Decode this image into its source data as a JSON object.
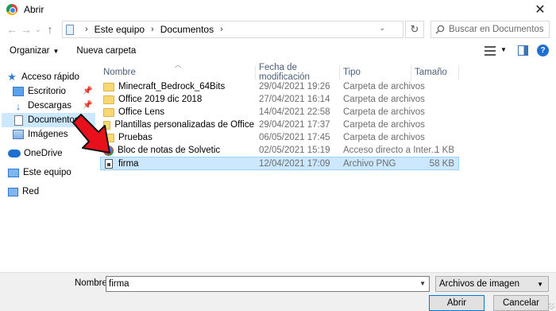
{
  "window": {
    "title": "Abrir",
    "close_glyph": "✕"
  },
  "nav_buttons": {
    "back": "←",
    "forward": "→",
    "recent": "⌄",
    "up": "↑"
  },
  "address": {
    "breadcrumbs": [
      "Este equipo",
      "Documentos"
    ],
    "separator": "›",
    "dropdown_glyph": "⌄",
    "refresh_glyph": "↻"
  },
  "search": {
    "placeholder": "Buscar en Documentos",
    "value": ""
  },
  "toolbar": {
    "organize_label": "Organizar",
    "new_folder_label": "Nueva carpeta"
  },
  "sidebar": {
    "items": [
      {
        "label": "Acceso rápido",
        "icon": "star-icon"
      },
      {
        "label": "Escritorio",
        "icon": "desktop-icon"
      },
      {
        "label": "Descargas",
        "icon": "download-icon"
      },
      {
        "label": "Documentos",
        "icon": "documents-icon",
        "selected": true
      },
      {
        "label": "Imágenes",
        "icon": "images-icon"
      },
      {
        "label": "OneDrive",
        "icon": "cloud-icon"
      },
      {
        "label": "Este equipo",
        "icon": "computer-icon"
      },
      {
        "label": "Red",
        "icon": "network-icon"
      }
    ]
  },
  "columns": {
    "name": "Nombre",
    "date": "Fecha de modificación",
    "type": "Tipo",
    "size": "Tamaño"
  },
  "files": [
    {
      "name": "Minecraft_Bedrock_64Bits",
      "date": "29/04/2021 19:26",
      "type": "Carpeta de archivos",
      "size": "",
      "icon": "folder-icon"
    },
    {
      "name": "Office 2019 dic 2018",
      "date": "27/04/2021 16:14",
      "type": "Carpeta de archivos",
      "size": "",
      "icon": "folder-icon"
    },
    {
      "name": "Office Lens",
      "date": "14/04/2021 22:58",
      "type": "Carpeta de archivos",
      "size": "",
      "icon": "folder-icon"
    },
    {
      "name": "Plantillas personalizadas de Office",
      "date": "29/04/2021 17:37",
      "type": "Carpeta de archivos",
      "size": "",
      "icon": "folder-icon"
    },
    {
      "name": "Pruebas",
      "date": "06/05/2021 17:45",
      "type": "Carpeta de archivos",
      "size": "",
      "icon": "folder-icon"
    },
    {
      "name": "Bloc de notas de Solvetic",
      "date": "02/05/2021 15:19",
      "type": "Acceso directo a Inter...",
      "size": "1 KB",
      "icon": "shortcut-icon"
    },
    {
      "name": "firma",
      "date": "12/04/2021 17:09",
      "type": "Archivo PNG",
      "size": "58 KB",
      "icon": "png-file-icon",
      "selected": true
    }
  ],
  "footer": {
    "name_label": "Nombre:",
    "name_value": "firma",
    "file_type": "Archivos de imagen",
    "open_label": "Abrir",
    "cancel_label": "Cancelar"
  },
  "colors": {
    "selection": "#cce8ff",
    "accent": "#0078d7",
    "annotation_arrow": "#e8101a"
  }
}
